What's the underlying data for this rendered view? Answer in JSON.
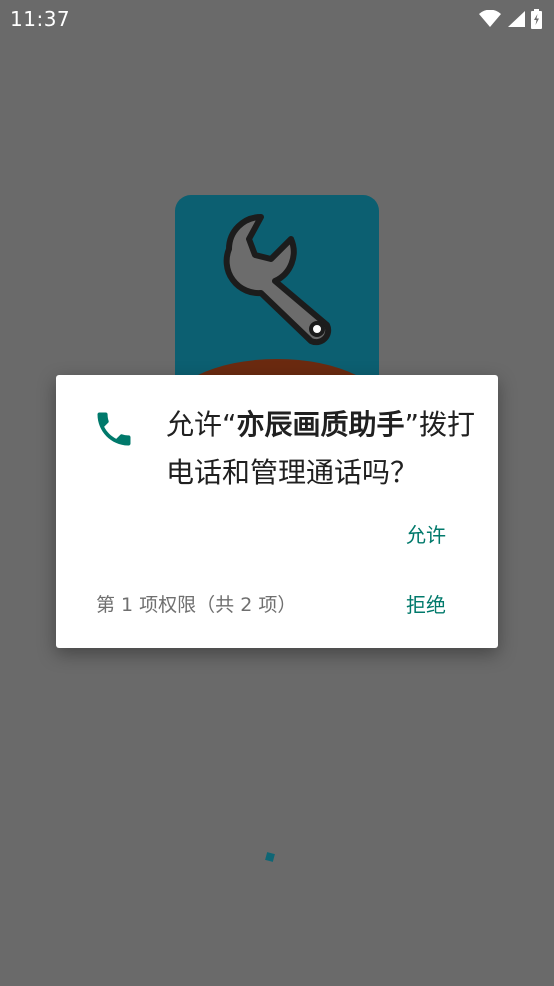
{
  "status_bar": {
    "time": "11:37",
    "icons": [
      "wifi-icon",
      "cell-signal-icon",
      "battery-charging-icon"
    ]
  },
  "dialog": {
    "icon": "phone-icon",
    "title_prefix": "允许“",
    "app_name": "亦辰画质助手",
    "title_suffix": "”拨打电话和管理通话吗？",
    "allow_label": "允许",
    "deny_label": "拒绝",
    "counter": "第 1 项权限（共 2 项）"
  },
  "colors": {
    "scrim": "#6a6a6a",
    "accent": "#00796b",
    "logo_bg": "#0c5f71"
  }
}
